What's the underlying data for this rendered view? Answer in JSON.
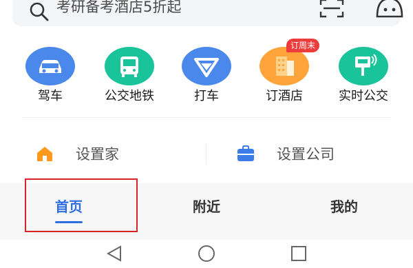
{
  "search": {
    "placeholder_text": "考研备考酒店5折起"
  },
  "quick_actions": [
    {
      "label": "驾车",
      "icon": "car-icon",
      "color": "#4a88ec"
    },
    {
      "label": "公交地铁",
      "icon": "bus-icon",
      "color": "#19c49a"
    },
    {
      "label": "打车",
      "icon": "taxi-icon",
      "color": "#4a88ec"
    },
    {
      "label": "订酒店",
      "icon": "hotel-icon",
      "color": "#ffa43a",
      "badge": "订周末"
    },
    {
      "label": "实时公交",
      "icon": "bus-stop-icon",
      "color": "#19c49a"
    }
  ],
  "shortcuts": {
    "home_label": "设置家",
    "company_label": "设置公司"
  },
  "tabs": {
    "home": "首页",
    "nearby": "附近",
    "mine": "我的"
  },
  "colors": {
    "accent": "#2e6de0",
    "highlight": "#d9232b",
    "badge": "#ee3b3b"
  }
}
